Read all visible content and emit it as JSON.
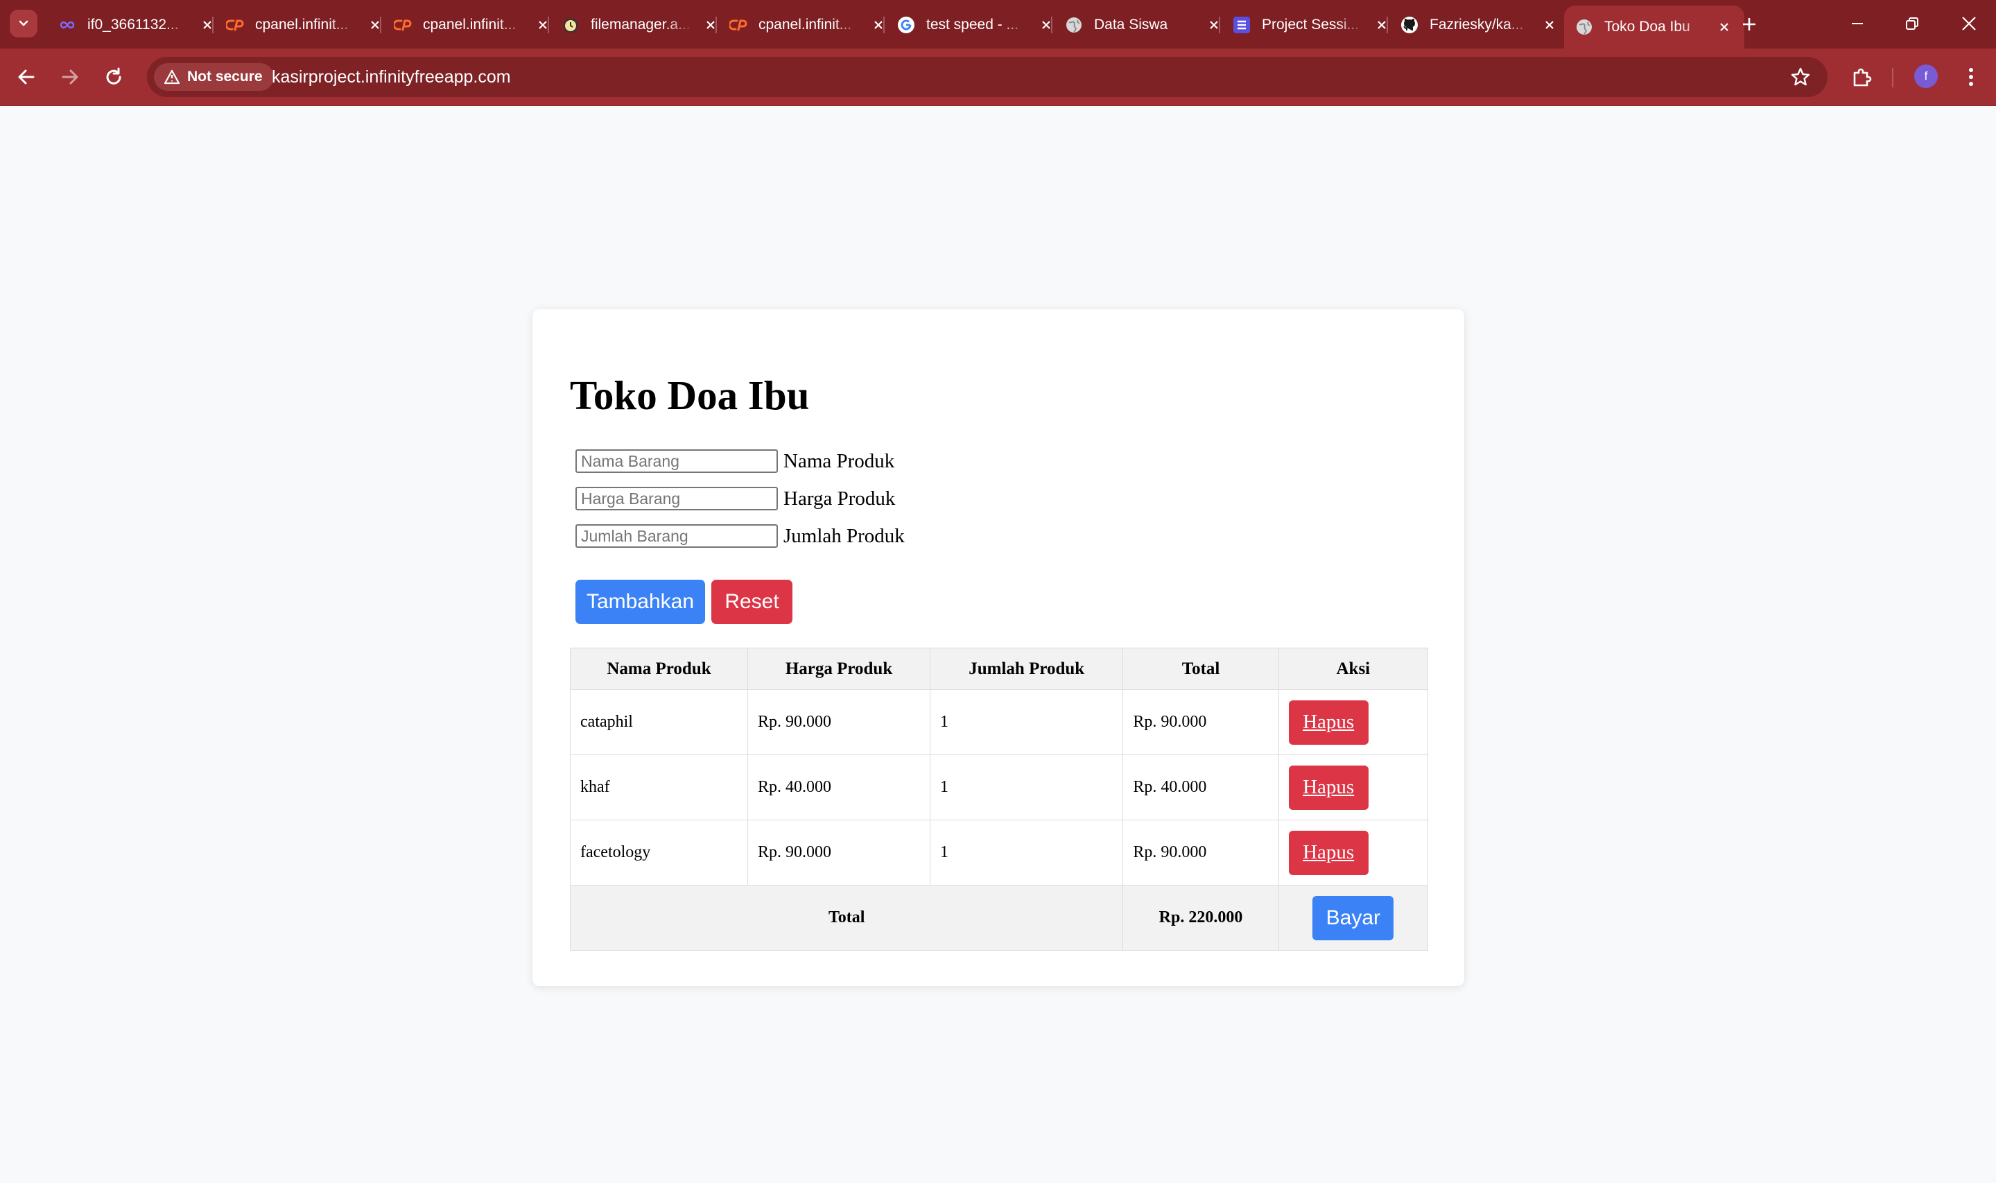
{
  "browser": {
    "tabs": [
      {
        "title": "if0_3661132...",
        "icon": "infinity-icon",
        "active": false
      },
      {
        "title": "cpanel.infinit...",
        "icon": "cpanel-icon",
        "active": false
      },
      {
        "title": "cpanel.infinit...",
        "icon": "cpanel-icon",
        "active": false
      },
      {
        "title": "filemanager.a...",
        "icon": "filemanager-icon",
        "active": false
      },
      {
        "title": "cpanel.infinit...",
        "icon": "cpanel-icon",
        "active": false
      },
      {
        "title": "test speed - ...",
        "icon": "google-icon",
        "active": false
      },
      {
        "title": "Data Siswa",
        "icon": "globe-icon",
        "active": false
      },
      {
        "title": "Project Sessi...",
        "icon": "list-icon",
        "active": false
      },
      {
        "title": "Fazriesky/ka...",
        "icon": "github-icon",
        "active": false
      },
      {
        "title": "Toko Doa Ibu",
        "icon": "globe-icon",
        "active": true
      }
    ],
    "security_label": "Not secure",
    "url": "kasirproject.infinityfreeapp.com",
    "profile_initial": "f",
    "theme_color": "#9e2e32"
  },
  "page": {
    "title": "Toko Doa Ibu",
    "form": {
      "fields": [
        {
          "placeholder": "Nama Barang",
          "label": "Nama Produk",
          "value": ""
        },
        {
          "placeholder": "Harga Barang",
          "label": "Harga Produk",
          "value": ""
        },
        {
          "placeholder": "Jumlah Barang",
          "label": "Jumlah Produk",
          "value": ""
        }
      ],
      "add_button": "Tambahkan",
      "reset_button": "Reset"
    },
    "table": {
      "headers": [
        "Nama Produk",
        "Harga Produk",
        "Jumlah Produk",
        "Total",
        "Aksi"
      ],
      "rows": [
        {
          "nama": "cataphil",
          "harga": "Rp. 90.000",
          "jumlah": "1",
          "total": "Rp. 90.000",
          "aksi": "Hapus"
        },
        {
          "nama": "khaf",
          "harga": "Rp. 40.000",
          "jumlah": "1",
          "total": "Rp. 40.000",
          "aksi": "Hapus"
        },
        {
          "nama": "facetology",
          "harga": "Rp. 90.000",
          "jumlah": "1",
          "total": "Rp. 90.000",
          "aksi": "Hapus"
        }
      ],
      "total_label": "Total",
      "grand_total": "Rp. 220.000",
      "pay_button": "Bayar"
    },
    "colors": {
      "primary": "#3b82f6",
      "danger": "#dc3545",
      "background": "#f8f9fa"
    }
  }
}
